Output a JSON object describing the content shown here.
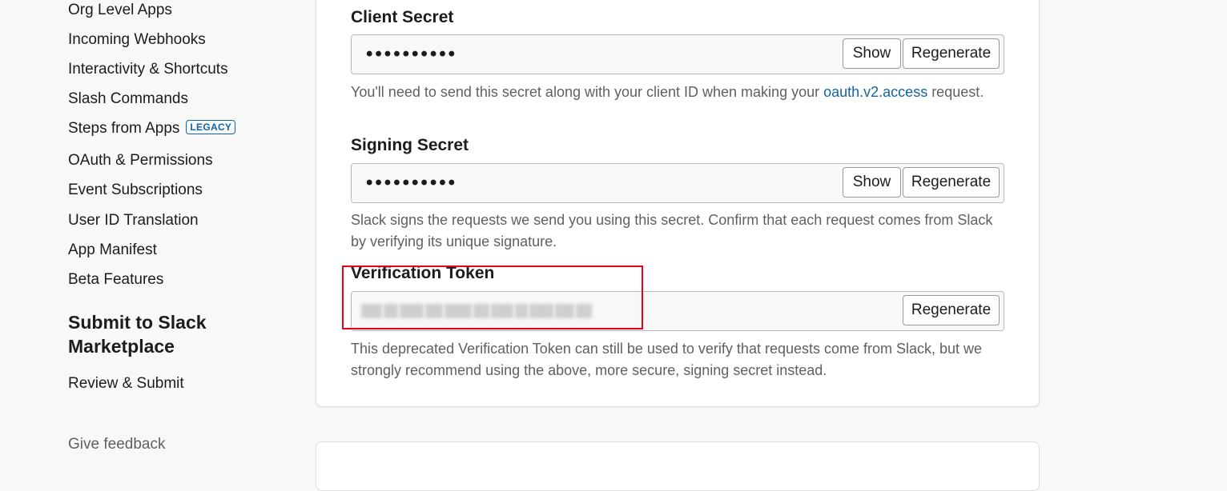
{
  "sidebar": {
    "items": [
      {
        "label": "Org Level Apps"
      },
      {
        "label": "Incoming Webhooks"
      },
      {
        "label": "Interactivity & Shortcuts"
      },
      {
        "label": "Slash Commands"
      },
      {
        "label": "Steps from Apps",
        "badge": "LEGACY"
      },
      {
        "label": "OAuth & Permissions"
      },
      {
        "label": "Event Subscriptions"
      },
      {
        "label": "User ID Translation"
      },
      {
        "label": "App Manifest"
      },
      {
        "label": "Beta Features"
      }
    ],
    "section_title": "Submit to Slack Marketplace",
    "section_items": [
      {
        "label": "Review & Submit"
      }
    ],
    "feedback": "Give feedback"
  },
  "credentials": {
    "client_secret": {
      "label": "Client Secret",
      "value": "••••••••••",
      "show_label": "Show",
      "regenerate_label": "Regenerate",
      "help_prefix": "You'll need to send this secret along with your client ID when making your ",
      "help_link": "oauth.v2.access",
      "help_suffix": " request."
    },
    "signing_secret": {
      "label": "Signing Secret",
      "value": "••••••••••",
      "show_label": "Show",
      "regenerate_label": "Regenerate",
      "help": "Slack signs the requests we send you using this secret. Confirm that each request comes from Slack by verifying its unique signature."
    },
    "verification_token": {
      "label": "Verification Token",
      "regenerate_label": "Regenerate",
      "help": "This deprecated Verification Token can still be used to verify that requests come from Slack, but we strongly recommend using the above, more secure, signing secret instead."
    }
  },
  "colors": {
    "link": "#1264a3",
    "highlight": "#e8001c",
    "background": "#f8f8f8"
  }
}
